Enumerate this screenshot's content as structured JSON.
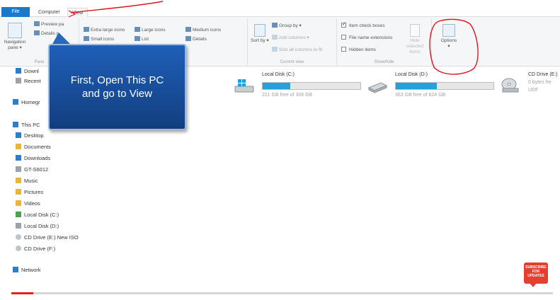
{
  "tabs": {
    "file": "File",
    "computer": "Computer",
    "view": "View"
  },
  "ribbon": {
    "panes": {
      "navigation_pane": "Navigation pane ▾",
      "preview_pane": "Preview pa",
      "details_pane": "Details p",
      "group": "Pane"
    },
    "layout": {
      "extra_large": "Extra large icons",
      "large": "Large icons",
      "medium": "Medium icons",
      "small": "Small icons",
      "list": "List",
      "details": "Details"
    },
    "current_view": {
      "sort_by": "Sort by ▾",
      "group_by": "Group by ▾",
      "add_columns": "Add columns ▾",
      "size_all": "Size all columns to fit",
      "group": "Current view"
    },
    "show_hide": {
      "item_check_boxes": "Item check boxes",
      "file_name_extensions": "File name extensions",
      "hidden_items": "Hidden items",
      "hide_selected": "Hide selected items",
      "group": "Show/hide"
    },
    "options": {
      "label": "Options",
      "arrow": "▾"
    }
  },
  "callout": {
    "line1": "First, Open This PC",
    "line2": "and go to View"
  },
  "nav": {
    "items": [
      {
        "label": "Downl",
        "icon": "downloads-icon"
      },
      {
        "label": "Recent",
        "icon": "recent-icon"
      },
      {
        "label": "Homegr",
        "icon": "homegroup-icon"
      },
      {
        "label": "This PC",
        "icon": "this-pc-icon"
      },
      {
        "label": "Desktop",
        "icon": "desktop-icon"
      },
      {
        "label": "Documents",
        "icon": "documents-icon"
      },
      {
        "label": "Downloads",
        "icon": "downloads-icon"
      },
      {
        "label": "GT-S6012",
        "icon": "phone-icon"
      },
      {
        "label": "Music",
        "icon": "music-icon"
      },
      {
        "label": "Pictures",
        "icon": "pictures-icon"
      },
      {
        "label": "Videos",
        "icon": "videos-icon"
      },
      {
        "label": "Local Disk (C:)",
        "icon": "drive-c-icon"
      },
      {
        "label": "Local Disk (D:)",
        "icon": "drive-d-icon"
      },
      {
        "label": "CD Drive (E:) New ISO",
        "icon": "cd-drive-icon"
      },
      {
        "label": "CD Drive (F:)",
        "icon": "cd-drive-icon"
      },
      {
        "label": "Network",
        "icon": "network-icon"
      }
    ]
  },
  "drives": [
    {
      "name": "Local Disk (C:)",
      "free": "221 GB free of 306 GB",
      "used_fraction": 0.28
    },
    {
      "name": "Local Disk (D:)",
      "free": "363 GB free of 624 GB",
      "used_fraction": 0.42
    },
    {
      "name": "CD Drive (E:)",
      "free": "0 bytes fre",
      "extra": "UDF"
    }
  ],
  "player": {
    "progress_fraction": 0.04,
    "subscribe": "SUBSCRIBE FOR UPDATES"
  },
  "colors": {
    "accent": "#1979ca",
    "callout": "#1a4f9e",
    "drive_fill": "#26a0da",
    "progress": "#e62117"
  }
}
